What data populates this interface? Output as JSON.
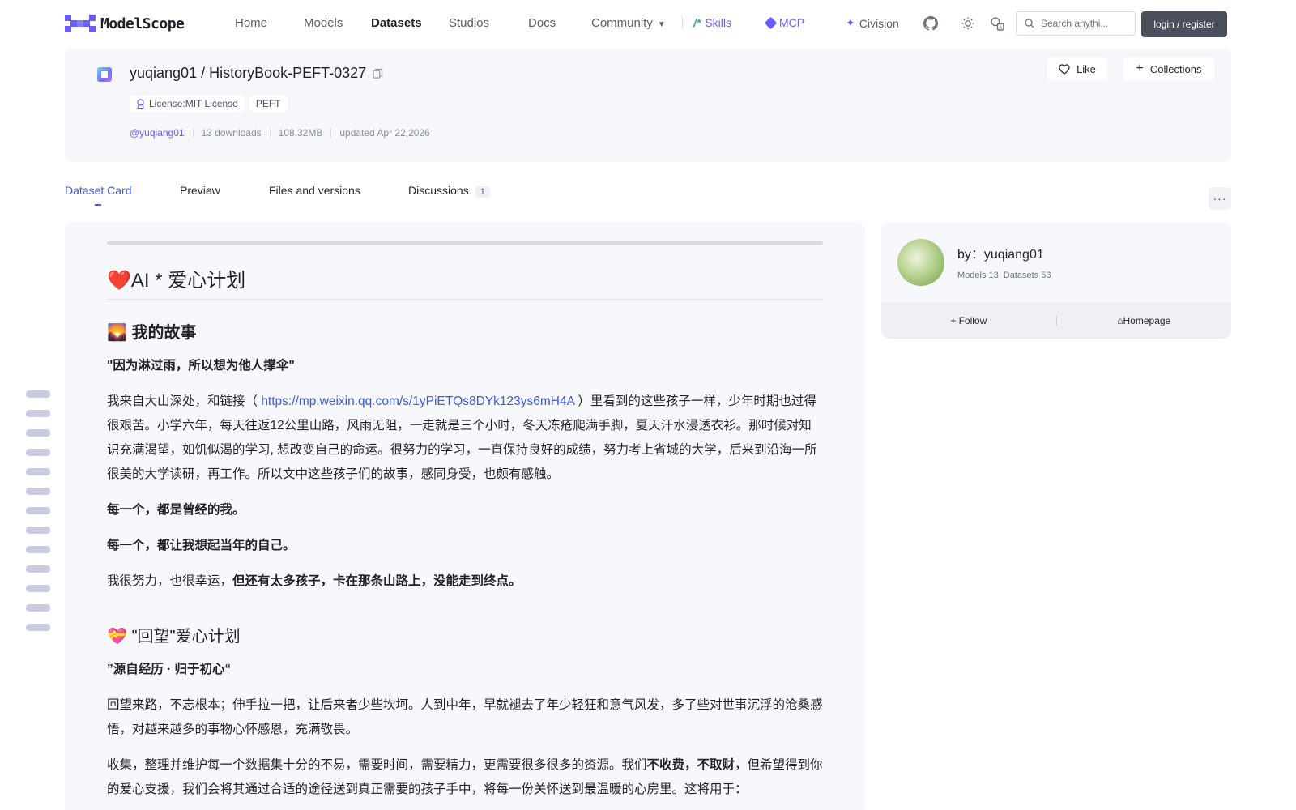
{
  "nav": {
    "logo_text": "ModelScope",
    "items": [
      "Home",
      "Models",
      "Datasets",
      "Studios",
      "Docs"
    ],
    "community": "Community",
    "skills": "Skills",
    "mcp": "MCP",
    "civision": "Civision",
    "search_placeholder": "Search anythi...",
    "login": "login / register"
  },
  "dataset": {
    "owner": "yuqiang01",
    "name": "HistoryBook-PEFT-0327",
    "tags": [
      "License:MIT License",
      "PEFT"
    ],
    "owner_handle": "@yuqiang01",
    "downloads": "13 downloads",
    "size": "108.32MB",
    "updated": "updated Apr 22,2026",
    "like": "Like",
    "collections": "Collections"
  },
  "tabs": [
    {
      "label": "Dataset Card"
    },
    {
      "label": "Preview"
    },
    {
      "label": "Files and versions"
    },
    {
      "label": "Discussions",
      "count": "1"
    }
  ],
  "more": "···",
  "card": {
    "h1": "❤️AI * 爱心计划",
    "h2_story": "🌄 我的故事",
    "quote1": "\"因为淋过雨，所以想为他人撑伞\"",
    "p1_a": "我来自大山深处，和链接（ ",
    "p1_link": "https://mp.weixin.qq.com/s/1yPiETQs8DYk123ys6mH4A",
    "p1_b": " ）里看到的这些孩子一样，少年时期也过得很艰苦。小学六年，每天往返12公里山路，风雨无阻，一走就是三个小时，冬天冻疮爬满手脚，夏天汗水浸透衣衫。那时候对知识充满渴望，如饥似渴的学习, 想改变自己的命运。很努力的学习，一直保持良好的成绩，努力考上省城的大学，后来到沿海一所很美的大学读研，再工作。所以文中这些孩子们的故事，感同身受，也颇有感触。",
    "b1": "每一个，都是曾经的我。",
    "b2": "每一个，都让我想起当年的自己。",
    "p2_a": "我很努力，也很幸运，",
    "p2_b": "但还有太多孩子，卡在那条山路上，没能走到终点。",
    "h2_plan": "💝 \"回望\"爱心计划",
    "quote2": "”源自经历 · 归于初心“",
    "p3": "回望来路，不忘根本；伸手拉一把，让后来者少些坎坷。人到中年，早就褪去了年少轻狂和意气风发，多了些对世事沉浮的沧桑感悟，对越来越多的事物心怀感恩，充满敬畏。",
    "p4_a": "收集，整理并维护每一个数据集十分的不易，需要时间，需要精力，更需要很多很多的资源。我们",
    "p4_b": "不收费，不取财",
    "p4_c": "，但希望得到你的爱心支援，我们会将其通过合适的途径送到真正需要的孩子手中，将每一份关怀送到最温暖的心房里。这将用于："
  },
  "author": {
    "name": "by：yuqiang01",
    "models": "Models 13",
    "datasets": "Datasets 53",
    "follow": "Follow",
    "homepage": "Homepage"
  },
  "colors": {
    "accent": "#6a5cf6",
    "link": "#3b5bdb",
    "login_bg": "#4a4f5c"
  }
}
